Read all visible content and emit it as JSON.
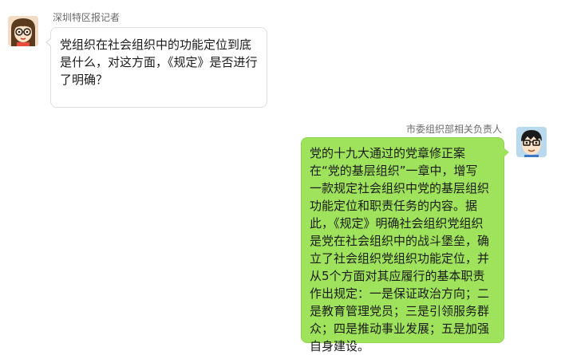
{
  "messages": [
    {
      "side": "left",
      "sender": "深圳特区报记者",
      "avatar_icon": "girl-with-glasses-avatar-icon",
      "lines": [
        "党组织在社会组织中的功能定位到底",
        "是什么，对这方面，《规定》是否进行",
        "了明确？"
      ]
    },
    {
      "side": "right",
      "sender": "市委组织部相关负责人",
      "avatar_icon": "boy-with-glasses-avatar-icon",
      "lines": [
        "党的十九大通过的党章修正案",
        "在“党的基层组织”一章中，增写",
        "一款规定社会组织中党的基层组织",
        "功能定位和职责任务的内容。据",
        "此，《规定》明确社会组织党组织",
        "是党在社会组织中的战斗堡垒，确",
        "立了社会组织党组织功能定位，并",
        "从5个方面对其应履行的基本职责",
        "作出规定：一是保证政治方向；二",
        "是教育管理党员；三是引领服务群",
        "众；四是推动事业发展；五是加强",
        "自身建设。"
      ]
    }
  ],
  "colors": {
    "left_bubble_bg": "#ffffff",
    "left_bubble_border": "#dedede",
    "right_bubble_bg": "#9fe35c",
    "sender_text": "#6a6a6a"
  }
}
